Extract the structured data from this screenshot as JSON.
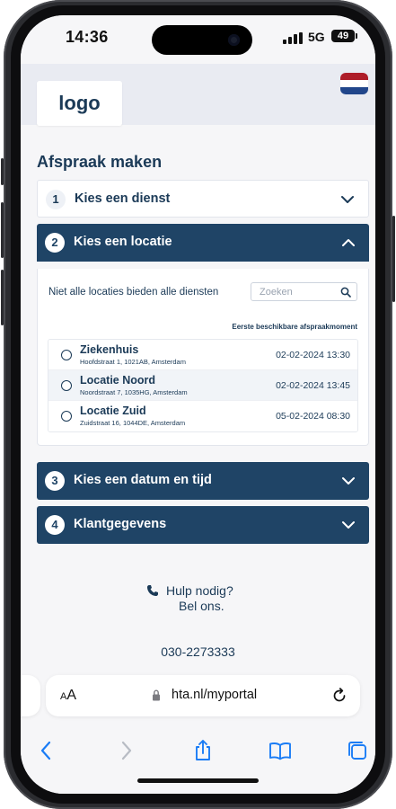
{
  "status_bar": {
    "time": "14:36",
    "network": "5G",
    "battery": "49"
  },
  "header": {
    "logo": "logo",
    "flag_colors": [
      "#ae1c28",
      "#ffffff",
      "#21468b"
    ]
  },
  "page_title": "Afspraak maken",
  "steps": [
    {
      "number": "1",
      "label": "Kies een dienst",
      "state": "collapsed"
    },
    {
      "number": "2",
      "label": "Kies een locatie",
      "state": "expanded"
    },
    {
      "number": "3",
      "label": "Kies een datum en tijd",
      "state": "collapsed"
    },
    {
      "number": "4",
      "label": "Klantgegevens",
      "state": "collapsed"
    }
  ],
  "location_panel": {
    "note": "Niet alle locaties bieden alle diensten",
    "search_placeholder": "Zoeken",
    "column_header": "Eerste beschikbare afspraakmoment",
    "locations": [
      {
        "name": "Ziekenhuis",
        "address": "Hoofdstraat 1, 1021AB, Amsterdam",
        "first_available": "02-02-2024 13:30"
      },
      {
        "name": "Locatie Noord",
        "address": "Noordstraat 7, 1035HG, Amsterdam",
        "first_available": "02-02-2024 13:45"
      },
      {
        "name": "Locatie Zuid",
        "address": "Zuidstraat 16, 1044DE, Amsterdam",
        "first_available": "05-02-2024 08:30"
      }
    ]
  },
  "help": {
    "line1": "Hulp nodig?",
    "line2": "Bel ons.",
    "phone": "030-2273333"
  },
  "browser": {
    "aa_large": "A",
    "aa_small": "A",
    "url": "hta.nl/myportal"
  },
  "colors": {
    "primary": "#1f4466",
    "text": "#1b3a57",
    "page_bg": "#f6f6f8",
    "header_bg": "#e9ebf2",
    "ios_blue": "#1a7cf5"
  }
}
